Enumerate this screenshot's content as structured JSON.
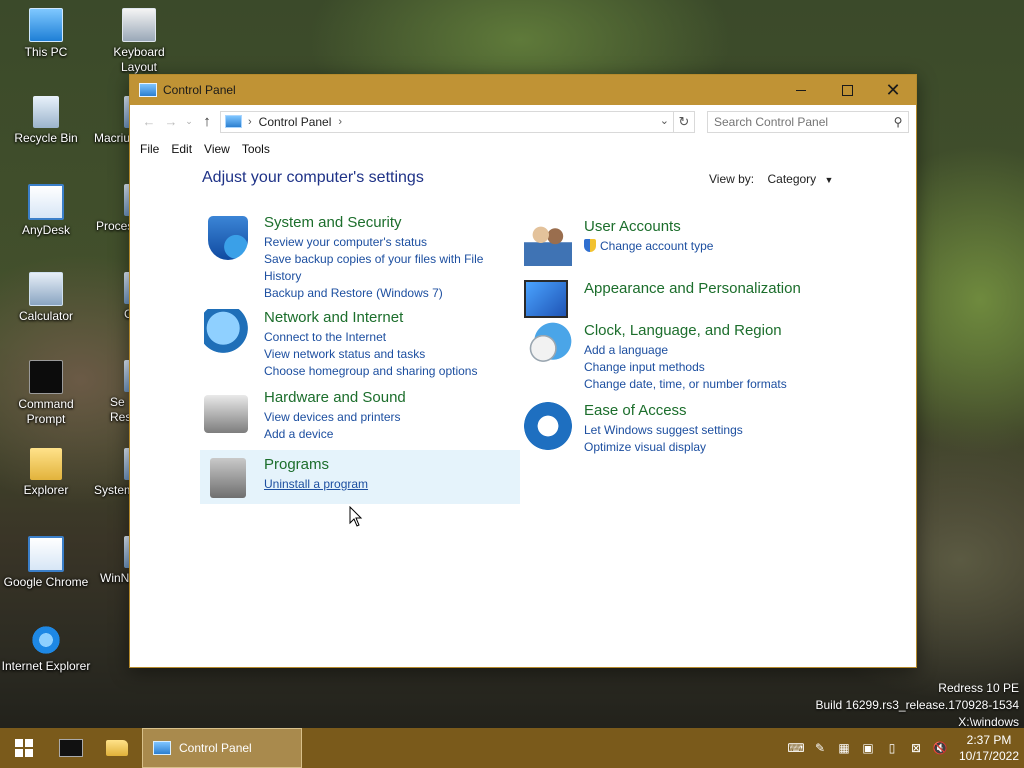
{
  "desktop": {
    "icons": [
      {
        "label": "This PC",
        "icon": "computer-icon"
      },
      {
        "label": "Keyboard Layout",
        "icon": "keyboard-icon"
      },
      {
        "label": "Recycle Bin",
        "icon": "recycle-bin-icon"
      },
      {
        "label": "Macriu",
        "icon": "app-icon"
      },
      {
        "label": "AnyDesk",
        "icon": "app-icon"
      },
      {
        "label": "Proces",
        "icon": "app-icon"
      },
      {
        "label": "Calculator",
        "icon": "calculator-icon"
      },
      {
        "label": "C",
        "icon": "app-icon"
      },
      {
        "label": "Command Prompt",
        "icon": "command-prompt-icon"
      },
      {
        "label": "Se Res",
        "icon": "app-icon"
      },
      {
        "label": "Explorer",
        "icon": "folder-icon"
      },
      {
        "label": "System",
        "icon": "app-icon"
      },
      {
        "label": "Google Chrome",
        "icon": "app-icon"
      },
      {
        "label": "WinN",
        "icon": "app-icon"
      },
      {
        "label": "Internet Explorer",
        "icon": "internet-explorer-icon"
      }
    ]
  },
  "window": {
    "title": "Control Panel",
    "breadcrumb": "Control Panel",
    "search_placeholder": "Search Control Panel",
    "menu": [
      "File",
      "Edit",
      "View",
      "Tools"
    ],
    "heading": "Adjust your computer's settings",
    "view_by_label": "View by:",
    "view_by_value": "Category"
  },
  "categories": {
    "system": {
      "title": "System and Security",
      "links": [
        "Review your computer's status",
        "Save backup copies of your files with File History",
        "Backup and Restore (Windows 7)"
      ]
    },
    "network": {
      "title": "Network and Internet",
      "links": [
        "Connect to the Internet",
        "View network status and tasks",
        "Choose homegroup and sharing options"
      ]
    },
    "hardware": {
      "title": "Hardware and Sound",
      "links": [
        "View devices and printers",
        "Add a device"
      ]
    },
    "programs": {
      "title": "Programs",
      "links": [
        "Uninstall a program"
      ]
    },
    "users": {
      "title": "User Accounts",
      "links": [
        "Change account type"
      ]
    },
    "appearance": {
      "title": "Appearance and Personalization",
      "links": []
    },
    "clock": {
      "title": "Clock, Language, and Region",
      "links": [
        "Add a language",
        "Change input methods",
        "Change date, time, or number formats"
      ]
    },
    "ease": {
      "title": "Ease of Access",
      "links": [
        "Let Windows suggest settings",
        "Optimize visual display"
      ]
    }
  },
  "watermark": {
    "line1": "Redress 10 PE",
    "line2": "Build 16299.rs3_release.170928-1534",
    "line3": "X:\\windows"
  },
  "taskbar": {
    "active_task": "Control Panel",
    "time": "2:37 PM",
    "date": "10/17/2022"
  },
  "colors": {
    "titlebar": "#c09335",
    "taskbar": "#7a5a1b",
    "category_title": "#1c6e2c",
    "link": "#1d4fa0",
    "heading": "#1e3287"
  }
}
